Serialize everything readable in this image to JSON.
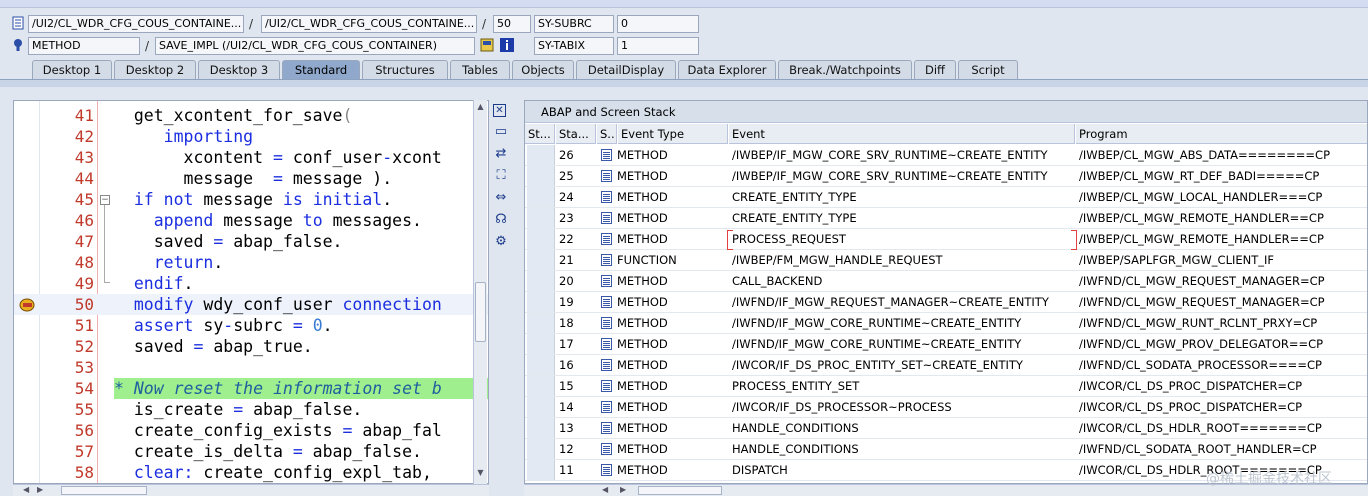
{
  "header": {
    "row1": {
      "field1": "/UI2/CL_WDR_CFG_COUS_CONTAINE...",
      "field2": "/UI2/CL_WDR_CFG_COUS_CONTAINE...",
      "line": "50",
      "var_name": "SY-SUBRC",
      "var_value": "0"
    },
    "row2": {
      "kind": "METHOD",
      "method": "SAVE_IMPL (/UI2/CL_WDR_CFG_COUS_CONTAINER)",
      "var_name": "SY-TABIX",
      "var_value": "1"
    }
  },
  "tabs": [
    "Desktop 1",
    "Desktop 2",
    "Desktop 3",
    "Standard",
    "Structures",
    "Tables",
    "Objects",
    "DetailDisplay",
    "Data Explorer",
    "Break./Watchpoints",
    "Diff",
    "Script"
  ],
  "active_tab": "Standard",
  "code": {
    "lines": [
      {
        "num": "41",
        "text": "  get_xcontent_for_save("
      },
      {
        "num": "42",
        "text": "     importing"
      },
      {
        "num": "43",
        "text": "       xcontent = conf_user-xcont"
      },
      {
        "num": "44",
        "text": "       message  = message )."
      },
      {
        "num": "45",
        "text": "  if not message is initial."
      },
      {
        "num": "46",
        "text": "    append message to messages."
      },
      {
        "num": "47",
        "text": "    saved = abap_false."
      },
      {
        "num": "48",
        "text": "    return."
      },
      {
        "num": "49",
        "text": "  endif."
      },
      {
        "num": "50",
        "text": "  modify wdy_conf_user connection"
      },
      {
        "num": "51",
        "text": "  assert sy-subrc = 0."
      },
      {
        "num": "52",
        "text": "  saved = abap_true."
      },
      {
        "num": "53",
        "text": ""
      },
      {
        "num": "54",
        "text": "* Now reset the information set b"
      },
      {
        "num": "55",
        "text": "  is_create = abap_false."
      },
      {
        "num": "56",
        "text": "  create_config_exists = abap_fal"
      },
      {
        "num": "57",
        "text": "  create_is_delta = abap_false."
      },
      {
        "num": "58",
        "text": "  clear: create_config_expl_tab,"
      }
    ]
  },
  "stack": {
    "title": "ABAP and Screen Stack",
    "columns": [
      "St...",
      "Sta...",
      "S..",
      "Event Type",
      "Event",
      "Program"
    ],
    "rows": [
      {
        "level": "26",
        "type": "METHOD",
        "event": "/IWBEP/IF_MGW_CORE_SRV_RUNTIME~CREATE_ENTITY",
        "program": "/IWBEP/CL_MGW_ABS_DATA========CP"
      },
      {
        "level": "25",
        "type": "METHOD",
        "event": "/IWBEP/IF_MGW_CORE_SRV_RUNTIME~CREATE_ENTITY",
        "program": "/IWBEP/CL_MGW_RT_DEF_BADI=====CP"
      },
      {
        "level": "24",
        "type": "METHOD",
        "event": "CREATE_ENTITY_TYPE",
        "program": "/IWBEP/CL_MGW_LOCAL_HANDLER===CP"
      },
      {
        "level": "23",
        "type": "METHOD",
        "event": "CREATE_ENTITY_TYPE",
        "program": "/IWBEP/CL_MGW_REMOTE_HANDLER==CP"
      },
      {
        "level": "22",
        "type": "METHOD",
        "event": "PROCESS_REQUEST",
        "program": "/IWBEP/CL_MGW_REMOTE_HANDLER==CP"
      },
      {
        "level": "21",
        "type": "FUNCTION",
        "event": "/IWBEP/FM_MGW_HANDLE_REQUEST",
        "program": "/IWBEP/SAPLFGR_MGW_CLIENT_IF"
      },
      {
        "level": "20",
        "type": "METHOD",
        "event": "CALL_BACKEND",
        "program": "/IWFND/CL_MGW_REQUEST_MANAGER=CP"
      },
      {
        "level": "19",
        "type": "METHOD",
        "event": "/IWFND/IF_MGW_REQUEST_MANAGER~CREATE_ENTITY",
        "program": "/IWFND/CL_MGW_REQUEST_MANAGER=CP"
      },
      {
        "level": "18",
        "type": "METHOD",
        "event": "/IWFND/IF_MGW_CORE_RUNTIME~CREATE_ENTITY",
        "program": "/IWFND/CL_MGW_RUNT_RCLNT_PRXY=CP"
      },
      {
        "level": "17",
        "type": "METHOD",
        "event": "/IWFND/IF_MGW_CORE_RUNTIME~CREATE_ENTITY",
        "program": "/IWFND/CL_MGW_PROV_DELEGATOR==CP"
      },
      {
        "level": "16",
        "type": "METHOD",
        "event": "/IWCOR/IF_DS_PROC_ENTITY_SET~CREATE_ENTITY",
        "program": "/IWFND/CL_SODATA_PROCESSOR====CP"
      },
      {
        "level": "15",
        "type": "METHOD",
        "event": "PROCESS_ENTITY_SET",
        "program": "/IWCOR/CL_DS_PROC_DISPATCHER=CP"
      },
      {
        "level": "14",
        "type": "METHOD",
        "event": "/IWCOR/IF_DS_PROCESSOR~PROCESS",
        "program": "/IWCOR/CL_DS_PROC_DISPATCHER=CP"
      },
      {
        "level": "13",
        "type": "METHOD",
        "event": "HANDLE_CONDITIONS",
        "program": "/IWCOR/CL_DS_HDLR_ROOT=======CP"
      },
      {
        "level": "12",
        "type": "METHOD",
        "event": "HANDLE_CONDITIONS",
        "program": "/IWFND/CL_SODATA_ROOT_HANDLER=CP"
      },
      {
        "level": "11",
        "type": "METHOD",
        "event": "DISPATCH",
        "program": "/IWCOR/CL_DS_HDLR_ROOT=======CP"
      }
    ]
  },
  "watermark": "@稀土掘金技术社区",
  "colors": {
    "accent": "#8fa8cc",
    "comment_bg": "#9fef8e",
    "keyword": "#1a2ee0",
    "linenum": "#c0392b"
  }
}
